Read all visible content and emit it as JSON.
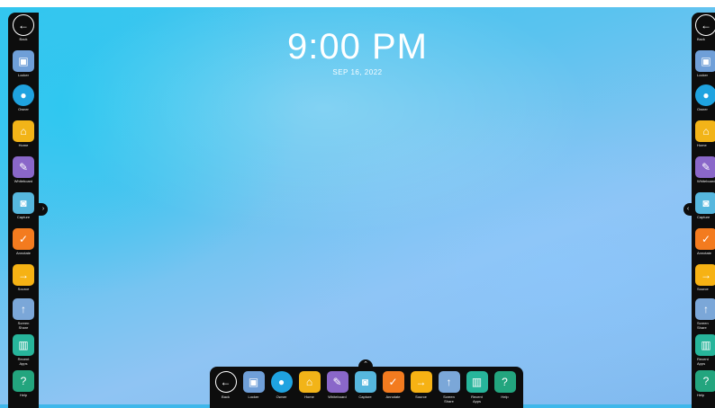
{
  "clock": {
    "time": "9:00 PM",
    "date": "SEP 16, 2022"
  },
  "apps": [
    {
      "label": "Back",
      "icon": "back-arrow-icon",
      "glyph": "←",
      "color": "transparent",
      "style": "back"
    },
    {
      "label": "Locker",
      "icon": "locker-icon",
      "glyph": "▣",
      "color": "#6f9fd8"
    },
    {
      "label": "Owner",
      "icon": "owner-icon",
      "glyph": "●",
      "color": "#1fa3e0",
      "style": "owner"
    },
    {
      "label": "Home",
      "icon": "home-icon",
      "glyph": "⌂",
      "color": "#f2b418"
    },
    {
      "label": "Whiteboard",
      "icon": "whiteboard-icon",
      "glyph": "✎",
      "color": "#8a67c9"
    },
    {
      "label": "Capture",
      "icon": "camera-icon",
      "glyph": "◙",
      "color": "#56b7de"
    },
    {
      "label": "Annotate",
      "icon": "annotate-icon",
      "glyph": "✓",
      "color": "#f37b1f"
    },
    {
      "label": "Source",
      "icon": "source-icon",
      "glyph": "→",
      "color": "#f6b214"
    },
    {
      "label": "Screen\nShare",
      "icon": "screen-share-icon",
      "glyph": "↑",
      "color": "#7ba7d8"
    },
    {
      "label": "Recent\nApps",
      "icon": "recent-apps-icon",
      "glyph": "▥",
      "color": "#27b59b"
    },
    {
      "label": "Help",
      "icon": "help-icon",
      "glyph": "?",
      "color": "#23a57e"
    }
  ],
  "pull_left": "›",
  "pull_right": "‹",
  "dock_handle": "⌃"
}
